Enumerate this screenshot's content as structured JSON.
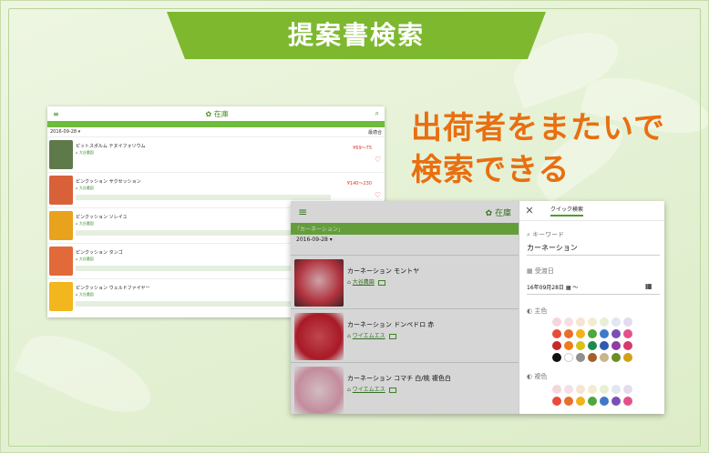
{
  "banner": {
    "title": "提案書検索",
    "color": "#7db82f"
  },
  "headline": {
    "line1": "出荷者をまたいで",
    "line2": "検索できる",
    "color": "#e96f10"
  },
  "shot_back": {
    "title": "在庫",
    "date": "2016-09-28",
    "sort_label": "最適合",
    "items": [
      {
        "name": "ピットスポルム テヌイフォリウム",
        "grower": "大谷農園",
        "price": "¥69～75",
        "thumb_color": "#5f7a4a"
      },
      {
        "name": "ピンクッション サクセッション",
        "grower": "大谷農園",
        "price": "¥140～230",
        "thumb_color": "#d9613a"
      },
      {
        "name": "ピンクッション ソレイユ",
        "grower": "大谷農園",
        "price": "",
        "thumb_color": "#e8a21c"
      },
      {
        "name": "ピンクッション タンゴ",
        "grower": "大谷農園",
        "price": "",
        "thumb_color": "#e2693a"
      },
      {
        "name": "ピンクッション ウェルドファイヤー",
        "grower": "大谷農園",
        "price": "",
        "thumb_color": "#f2b61e"
      }
    ]
  },
  "shot_front": {
    "title": "在庫",
    "search_tag": "「カーネーション」",
    "date": "2016-09-28",
    "items": [
      {
        "name": "カーネーション モントヤ",
        "grower": "大谷農園",
        "thumb_color": "#d13b4a"
      },
      {
        "name": "カーネーション ドンペドロ 赤",
        "grower": "ワイエムエス",
        "thumb_color": "#c91f2e"
      },
      {
        "name": "カーネーション コマチ 白/桃 複色白",
        "grower": "ワイエムエス",
        "thumb_color": "#e9a7bb"
      }
    ],
    "panel": {
      "title": "クイック検索",
      "keyword_label": "キーワード",
      "keyword_value": "カーネーション",
      "date_label": "受渡日",
      "date_value": "16年09月28日",
      "date_sep": "～",
      "main_color_label": "主色",
      "sub_color_label": "複色",
      "main_colors": [
        "#f5d6dc",
        "#f6dfe3",
        "#f7e4d2",
        "#f4ecd0",
        "#e7efd4",
        "#dfe7f2",
        "#e4dbef",
        "#e84b3c",
        "#e76f2a",
        "#f2b21b",
        "#4fa63b",
        "#3e78c8",
        "#7b4fb6",
        "#e54f8c",
        "#c52a2a",
        "#f07c1c",
        "#d4c21a",
        "#1c8a4f",
        "#2f5bb3",
        "#8e3da3",
        "#d83a6d",
        "#111111",
        "#ffffff",
        "#8f8f8f",
        "#a35f2a",
        "#c8b58a",
        "#6b8e23",
        "#d4a017"
      ],
      "sub_colors": [
        "#f5d6dc",
        "#f6dfe3",
        "#f7e4d2",
        "#f4ecd0",
        "#e7efd4",
        "#dfe7f2",
        "#e4dbef",
        "#e84b3c",
        "#e76f2a",
        "#f2b21b",
        "#4fa63b",
        "#3e78c8",
        "#7b4fb6",
        "#e54f8c"
      ]
    }
  }
}
